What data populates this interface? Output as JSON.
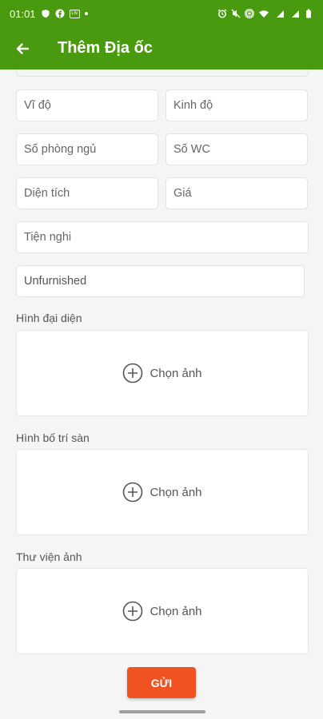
{
  "status_bar": {
    "time": "01:01",
    "icons": [
      "shield-icon",
      "facebook-icon",
      "notification-icon",
      "dot-icon",
      "alarm-icon",
      "mute-icon",
      "hotspot-icon",
      "wifi-icon",
      "signal-icon",
      "battery-icon"
    ]
  },
  "app_bar": {
    "title": "Thêm Địa ốc",
    "back_icon": "arrow-left-icon"
  },
  "form": {
    "latitude_placeholder": "Vĩ độ",
    "longitude_placeholder": "Kinh độ",
    "bedrooms_placeholder": "Số phòng ngủ",
    "wc_placeholder": "Số WC",
    "area_placeholder": "Diện tích",
    "price_placeholder": "Giá",
    "amenities_placeholder": "Tiện nghi",
    "furnishing_value": "Unfurnished"
  },
  "sections": {
    "avatar_label": "Hình đại diện",
    "floorplan_label": "Hình bố trí sàn",
    "gallery_label": "Thư viện ảnh",
    "choose_image_label": "Chọn ảnh"
  },
  "submit_label": "GỬI",
  "colors": {
    "primary": "#4a9a10",
    "accent": "#f05321"
  }
}
